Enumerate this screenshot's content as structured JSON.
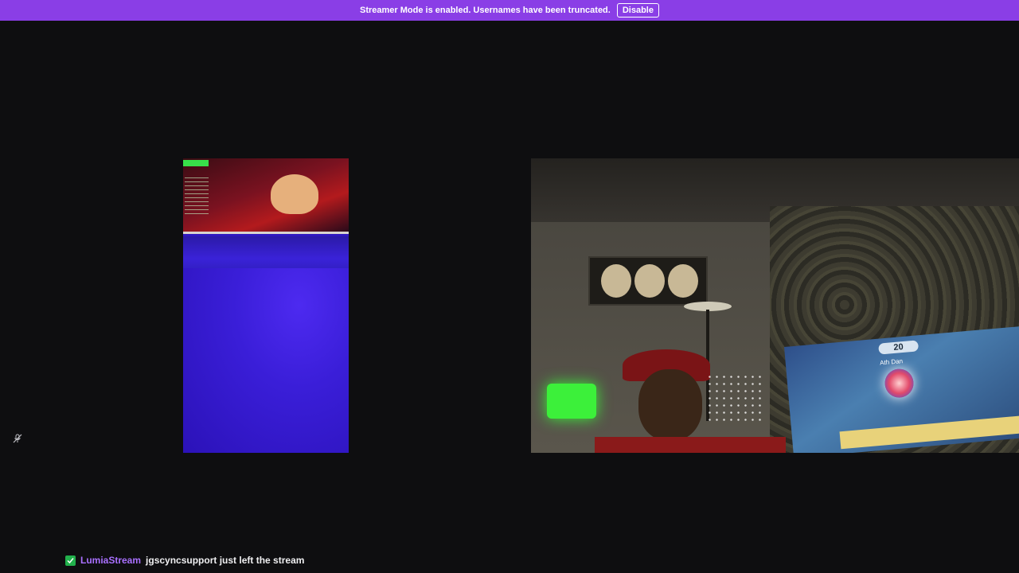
{
  "banner": {
    "message": "Streamer Mode is enabled. Usernames have been truncated.",
    "disable_label": "Disable"
  },
  "webcam_overlay": {
    "score": "20",
    "player_name": "Ath Dan"
  },
  "chat": {
    "username": "LumiaStream",
    "message": "jgscyncsupport just left the stream"
  },
  "icons": {
    "mute": "mute-icon",
    "chat_badge": "verified-badge-icon"
  },
  "colors": {
    "banner_bg": "#8a3ee6",
    "page_bg": "#0e0e10",
    "username": "#a970ff",
    "badge": "#22b14c"
  }
}
